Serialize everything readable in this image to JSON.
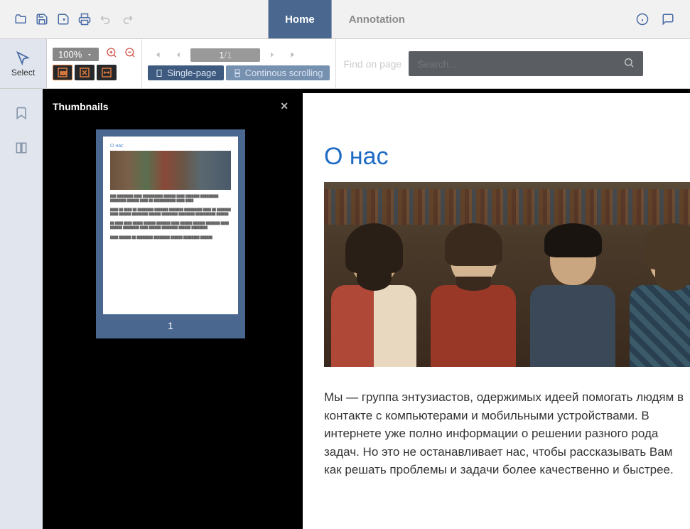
{
  "tabs": {
    "home": "Home",
    "annotation": "Annotation"
  },
  "toolbar": {
    "select": "Select",
    "zoom": "100%",
    "page_current": "1",
    "page_sep": "/",
    "page_total": "1",
    "mode_single": "Single-page",
    "mode_continuous": "Continous scrolling",
    "find_label": "Find on page",
    "search_placeholder": "Search..."
  },
  "panel": {
    "title": "Thumbnails",
    "thumb_num": "1",
    "thumb_heading": "О нас"
  },
  "document": {
    "heading": "О нас",
    "paragraph": "Мы — группа энтузиастов, одержимых идеей помогать людям в контакте с компьютерами и мобильными устройствами. В интернете уже полно информации о решении разного рода задач. Но это не останавливает нас, чтобы рассказывать Вам как решать проблемы и задачи более качественно и быстрее."
  }
}
